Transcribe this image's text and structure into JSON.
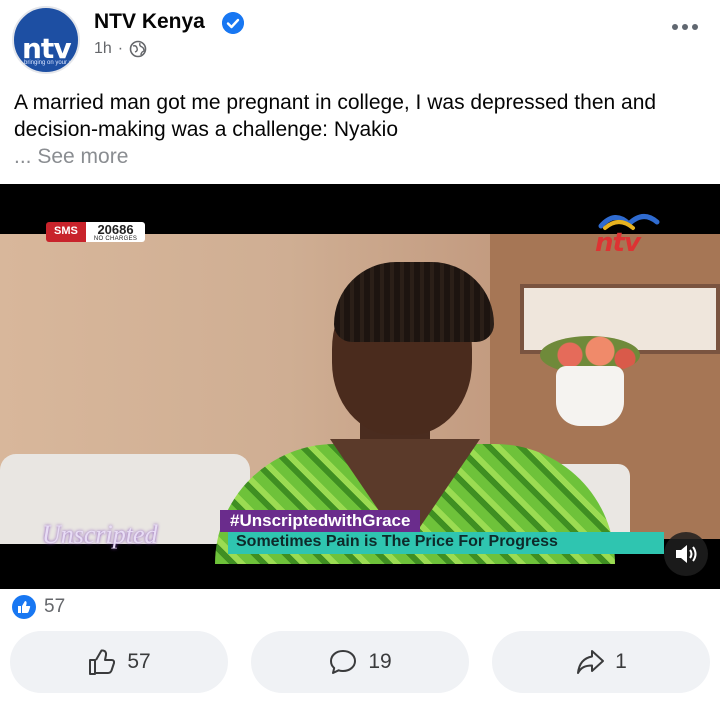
{
  "post": {
    "page_name": "NTV Kenya",
    "time": "1h",
    "separator": "·",
    "caption": "A married man got me pregnant in college, I was depressed then and decision-making was a challenge: Nyakio",
    "see_more": "... See more",
    "avatar": {
      "logo_text": "ntv",
      "tagline": "bringing on your way"
    }
  },
  "video": {
    "sms_label": "SMS",
    "sms_number": "20686",
    "sms_sub": "NO CHARGES",
    "channel_logo": "ntv",
    "show_title": "Unscripted",
    "hashtag": "#UnscriptedwithGrace",
    "lower_third": "Sometimes Pain is The Price For Progress"
  },
  "reactions": {
    "count": "57"
  },
  "actions": {
    "like_count": "57",
    "comment_count": "19",
    "share_count": "1"
  },
  "colors": {
    "accent": "#1877f2",
    "button_bg": "#f0f2f5",
    "lower_third": "#2fc5b0",
    "hashtag_bg": "#6a2c8c"
  },
  "icons": [
    "verified-badge-icon",
    "globe-icon",
    "more-options-icon",
    "volume-icon",
    "like-reaction-icon",
    "thumbs-up-icon",
    "comment-icon",
    "share-icon"
  ]
}
